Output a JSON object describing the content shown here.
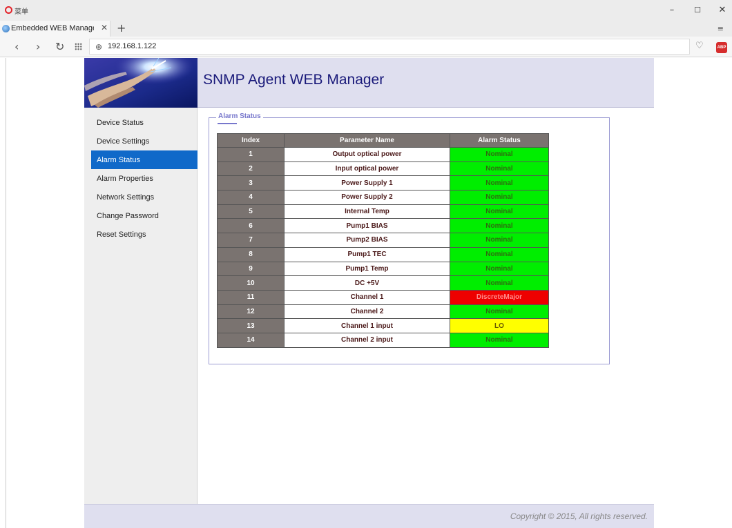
{
  "browser": {
    "menu_label": "菜单",
    "tab_title": "Embedded WEB Manage",
    "url": "192.168.1.122"
  },
  "header": {
    "title": "SNMP Agent WEB Manager"
  },
  "sidebar": {
    "items": [
      {
        "label": "Device Status"
      },
      {
        "label": "Device Settings"
      },
      {
        "label": "Alarm Status"
      },
      {
        "label": "Alarm Properties"
      },
      {
        "label": "Network Settings"
      },
      {
        "label": "Change Password"
      },
      {
        "label": "Reset Settings"
      }
    ],
    "active": "Alarm Status"
  },
  "alarm": {
    "legend": "Alarm Status",
    "columns": [
      "Index",
      "Parameter Name",
      "Alarm Status"
    ],
    "rows": [
      {
        "index": "1",
        "name": "Output optical power",
        "status": "Nominal",
        "level": "ok"
      },
      {
        "index": "2",
        "name": "Input optical power",
        "status": "Nominal",
        "level": "ok"
      },
      {
        "index": "3",
        "name": "Power Supply 1",
        "status": "Nominal",
        "level": "ok"
      },
      {
        "index": "4",
        "name": "Power Supply 2",
        "status": "Nominal",
        "level": "ok"
      },
      {
        "index": "5",
        "name": "Internal Temp",
        "status": "Nominal",
        "level": "ok"
      },
      {
        "index": "6",
        "name": "Pump1 BIAS",
        "status": "Nominal",
        "level": "ok"
      },
      {
        "index": "7",
        "name": "Pump2 BIAS",
        "status": "Nominal",
        "level": "ok"
      },
      {
        "index": "8",
        "name": "Pump1 TEC",
        "status": "Nominal",
        "level": "ok"
      },
      {
        "index": "9",
        "name": "Pump1 Temp",
        "status": "Nominal",
        "level": "ok"
      },
      {
        "index": "10",
        "name": "DC +5V",
        "status": "Nominal",
        "level": "ok"
      },
      {
        "index": "11",
        "name": "Channel 1",
        "status": "DiscreteMajor",
        "level": "major"
      },
      {
        "index": "12",
        "name": "Channel 2",
        "status": "Nominal",
        "level": "ok"
      },
      {
        "index": "13",
        "name": "Channel 1 input",
        "status": "LO",
        "level": "minor"
      },
      {
        "index": "14",
        "name": "Channel 2 input",
        "status": "Nominal",
        "level": "ok"
      }
    ]
  },
  "status_colors": {
    "ok": "#00ee00",
    "major": "#ee0000",
    "minor": "#ffff00"
  },
  "footer": {
    "copyright": "Copyright © 2015, All rights reserved."
  }
}
